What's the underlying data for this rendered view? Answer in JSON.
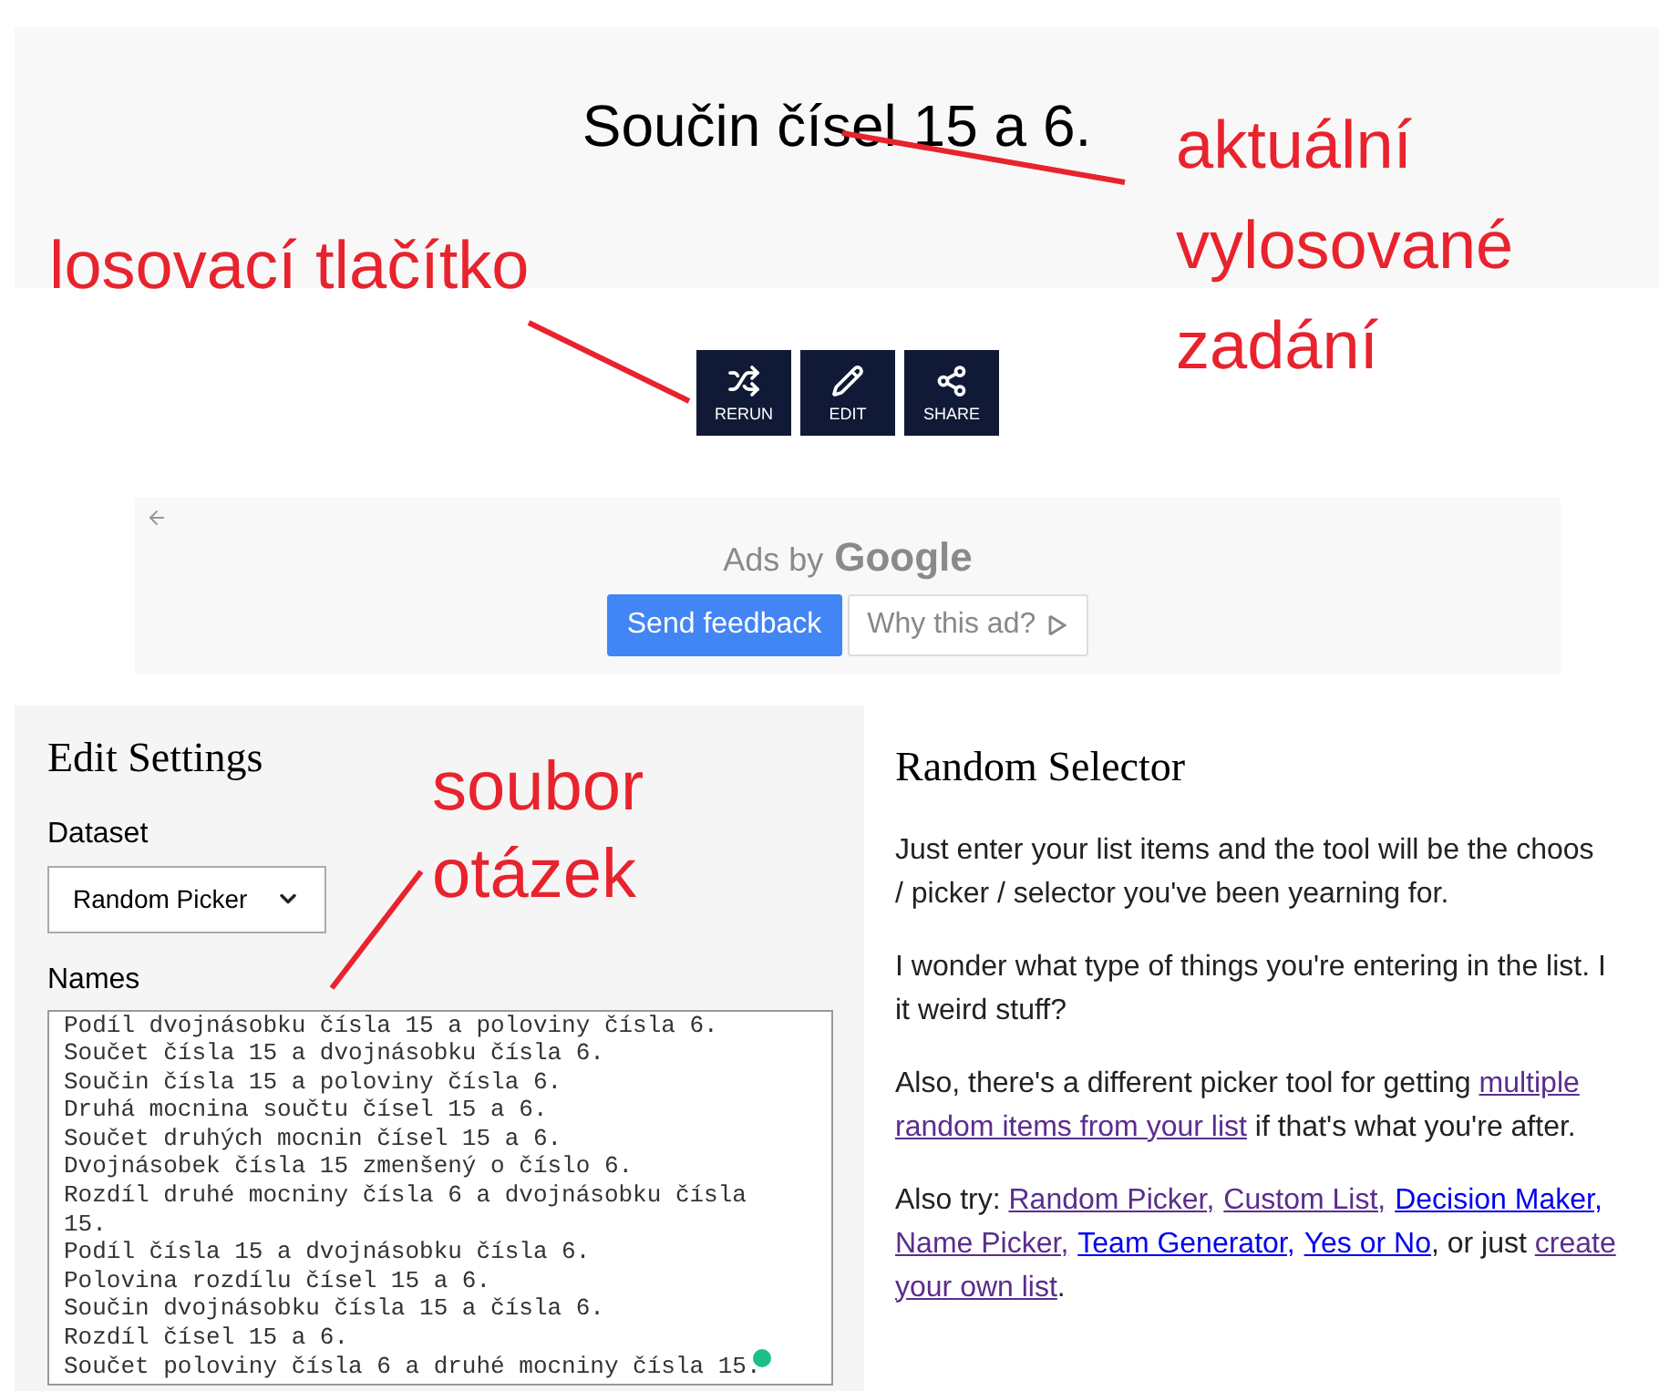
{
  "result": {
    "text": "Součin čísel 15 a 6."
  },
  "actions": [
    {
      "kind": "shuffle",
      "label": "RERUN"
    },
    {
      "kind": "edit",
      "label": "EDIT"
    },
    {
      "kind": "share",
      "label": "SHARE"
    }
  ],
  "ad": {
    "heading_prefix": "Ads by",
    "heading_brand": "Google",
    "feedback_button": "Send feedback",
    "why_button": "Why this ad?"
  },
  "settings": {
    "title": "Edit Settings",
    "dataset_label": "Dataset",
    "dataset_value": "Random Picker",
    "names_label": "Names",
    "names": [
      "Podíl dvojnásobku čísla 15 a poloviny čísla 6.",
      "Součet čísla 15 a dvojnásobku čísla 6.",
      "Součin čísla 15 a poloviny čísla 6.",
      "Druhá mocnina součtu čísel 15 a 6.",
      "Součet druhých mocnin čísel 15 a 6.",
      "Dvojnásobek čísla 15 zmenšený o číslo 6.",
      "Rozdíl druhé mocniny čísla 6 a dvojnásobku čísla 15.",
      "Podíl čísla 15 a dvojnásobku čísla 6.",
      "Polovina rozdílu čísel 15 a 6.",
      "Součin dvojnásobku čísla 15 a čísla 6.",
      "Rozdíl čísel 15 a 6.",
      "Součet poloviny čísla 6 a druhé mocniny čísla 15."
    ]
  },
  "about": {
    "title": "Random Selector",
    "paragraphs": [
      [
        [
          {
            "text": "Just enter your list items and the tool will be the choos"
          }
        ],
        [
          {
            "text": "/ picker / selector you've been yearning for."
          }
        ]
      ],
      [
        [
          {
            "text": "I wonder what type of things you're entering in the list. I"
          }
        ],
        [
          {
            "text": "it weird stuff?"
          }
        ]
      ],
      [
        [
          {
            "text": "Also, there's a different picker tool for getting "
          },
          {
            "text": "multiple",
            "link": true,
            "visited": true
          }
        ],
        [
          {
            "text": "random items from your list",
            "link": true,
            "visited": true
          },
          {
            "text": " if that's what you're after."
          }
        ]
      ],
      [
        [
          {
            "text": "Also try: "
          },
          {
            "text": "Random Picker,",
            "link": true,
            "visited": true
          },
          {
            "text": "Custom List,",
            "link": true,
            "visited": true
          },
          {
            "text": "Decision Maker,",
            "link": true,
            "visited": false
          }
        ],
        [
          {
            "text": "Name Picker,",
            "link": true,
            "visited": true
          },
          {
            "text": "Team Generator,",
            "link": true,
            "visited": false
          },
          {
            "text": "Yes or No",
            "link": true,
            "visited": false
          },
          {
            "text": ", or just "
          },
          {
            "text": "create",
            "link": true,
            "visited": true
          }
        ],
        [
          {
            "text": "your own list",
            "link": true,
            "visited": true
          },
          {
            "text": "."
          }
        ]
      ]
    ]
  },
  "annotations": [
    {
      "lines": [
        "losovací tlačítko"
      ]
    },
    {
      "lines": [
        "aktuální",
        "vylosované",
        "zadání"
      ]
    },
    {
      "lines": [
        "soubor",
        "otázek"
      ]
    }
  ]
}
